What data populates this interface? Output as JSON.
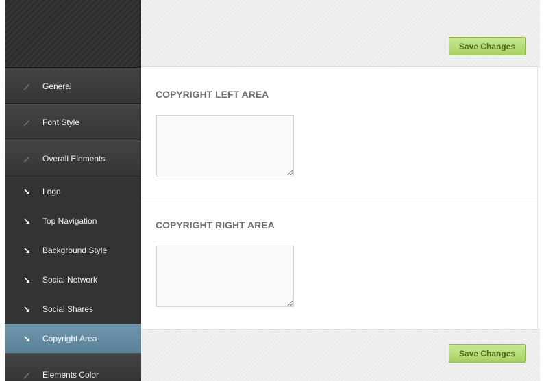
{
  "sidebar": {
    "main_items": [
      {
        "label": "General",
        "icon": "pencil-icon"
      },
      {
        "label": "Font Style",
        "icon": "pencil-icon"
      },
      {
        "label": "Overall Elements",
        "icon": "pencil-icon"
      }
    ],
    "sub_items": [
      {
        "label": "Logo",
        "icon": "arrow-down-right-icon"
      },
      {
        "label": "Top Navigation",
        "icon": "arrow-down-right-icon"
      },
      {
        "label": "Background Style",
        "icon": "arrow-down-right-icon"
      },
      {
        "label": "Social Network",
        "icon": "arrow-down-right-icon"
      },
      {
        "label": "Social Shares",
        "icon": "arrow-down-right-icon"
      },
      {
        "label": "Copyright Area",
        "icon": "arrow-down-right-icon",
        "active": true
      }
    ],
    "after_items": [
      {
        "label": "Elements Color",
        "icon": "pencil-icon"
      }
    ]
  },
  "toolbar": {
    "save_label_top": "Save Changes",
    "save_label_bottom": "Save Changes"
  },
  "sections": {
    "left": {
      "title": "COPYRIGHT LEFT AREA",
      "value": ""
    },
    "right": {
      "title": "COPYRIGHT RIGHT AREA",
      "value": ""
    }
  },
  "colors": {
    "active_item": "#5f8aa2",
    "save_button": "#b5dc74",
    "sidebar_bg": "#333333"
  }
}
